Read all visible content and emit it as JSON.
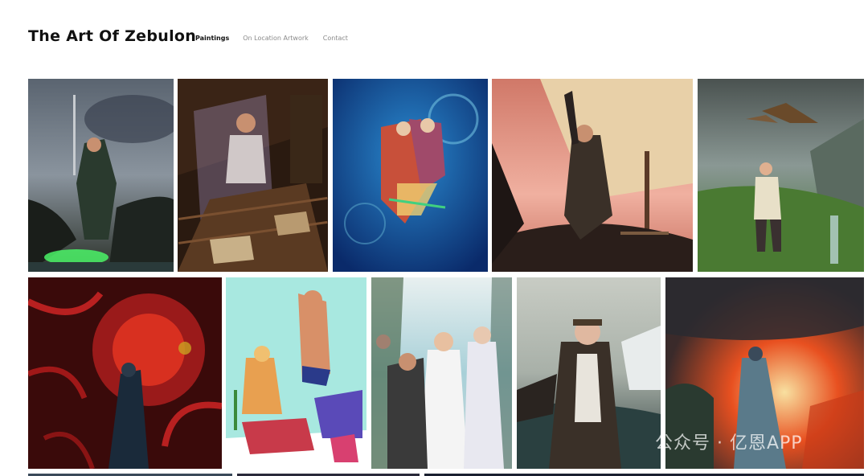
{
  "site": {
    "title": "The Art Of Zebulon"
  },
  "nav": {
    "items": [
      {
        "label": "Paintings",
        "active": true
      },
      {
        "label": "On Location Artwork",
        "active": false
      },
      {
        "label": "Contact",
        "active": false
      }
    ]
  },
  "watermark": {
    "text": "公众号 · 亿恩APP"
  },
  "gallery": {
    "palette": {
      "warrior": [
        "#3b4654",
        "#7a8694",
        "#2a3a2a",
        "#4cff6a"
      ],
      "reader": [
        "#3a2416",
        "#6b4a30",
        "#c8b8e8",
        "#1a0f08"
      ],
      "sorcerer": [
        "#0f3a7a",
        "#1e73b8",
        "#d94a2a",
        "#f0d070"
      ],
      "sailor": [
        "#3a2a28",
        "#e8d0a8",
        "#c87860",
        "#f0a0a0"
      ],
      "falconer": [
        "#4a5a5a",
        "#5a8a3a",
        "#e8e0c8",
        "#8a5a2a"
      ],
      "tentacles": [
        "#3a0808",
        "#b81a1a",
        "#e84020",
        "#1a2a3a"
      ],
      "poster": [
        "#a8e8e0",
        "#e8b088",
        "#c83a4a",
        "#5a4ab8"
      ],
      "wedding": [
        "#a8d0e0",
        "#f0f0f0",
        "#3a4a3a",
        "#e8e8f0"
      ],
      "aviator": [
        "#b8c0b8",
        "#2a3a3a",
        "#e8e0d8",
        "#5a4a3a"
      ],
      "fire": [
        "#2a2a30",
        "#e85020",
        "#f0c060",
        "#5a7a8a"
      ]
    }
  }
}
